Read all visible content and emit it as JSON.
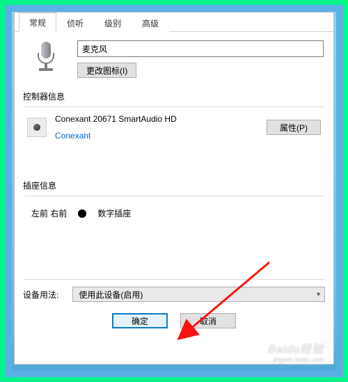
{
  "tabs": {
    "general": "常规",
    "listen": "侦听",
    "level": "级别",
    "advanced": "高级"
  },
  "device": {
    "name": "麦克风",
    "change_icon_label": "更改图标(I)"
  },
  "controller": {
    "section_label": "控制器信息",
    "name": "Conexant 20671 SmartAudio HD",
    "vendor": "Conexant",
    "properties_label": "属性(P)"
  },
  "jack": {
    "section_label": "插座信息",
    "position": "左前 右前",
    "type": "数字插座"
  },
  "usage": {
    "label": "设备用法:",
    "selected": "使用此设备(启用)"
  },
  "buttons": {
    "ok": "确定",
    "cancel": "取消"
  },
  "watermark": {
    "brand": "Baidu经验",
    "sub": "jingyan.baidu.com"
  }
}
